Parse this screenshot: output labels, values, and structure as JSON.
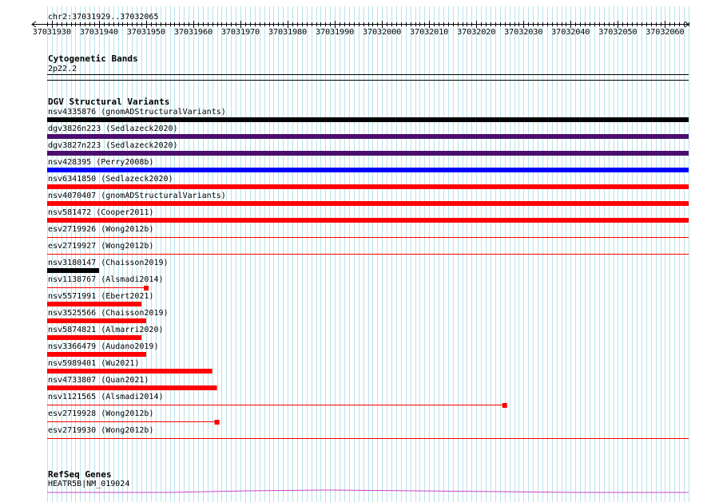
{
  "locus": "chr2:37031929..37032065",
  "ruler": {
    "start": 37031929,
    "end": 37032065,
    "tick_labels": [
      "37031930",
      "37031940",
      "37031950",
      "37031960",
      "37031970",
      "37031980",
      "37031990",
      "37032000",
      "37032010",
      "37032020",
      "37032030",
      "37032040",
      "37032050",
      "37032060"
    ]
  },
  "cytoband": {
    "title": "Cytogenetic Bands",
    "band": "2p22.2"
  },
  "dgv": {
    "title": "DGV Structural Variants",
    "variants": [
      {
        "label": "nsv4335876 (gnomADStructuralVariants)",
        "color": "#000000",
        "start": 37031929,
        "end": 37032065,
        "style": "bar"
      },
      {
        "label": "dgv3826n223 (Sedlazeck2020)",
        "color": "#4b0e6e",
        "start": 37031929,
        "end": 37032065,
        "style": "bar"
      },
      {
        "label": "dgv3827n223 (Sedlazeck2020)",
        "color": "#4b0e6e",
        "start": 37031929,
        "end": 37032065,
        "style": "bar"
      },
      {
        "label": "nsv428395 (Perry2008b)",
        "color": "#0000ff",
        "start": 37031929,
        "end": 37032065,
        "style": "bar"
      },
      {
        "label": "nsv6341850 (Sedlazeck2020)",
        "color": "#ff0000",
        "start": 37031929,
        "end": 37032065,
        "style": "bar"
      },
      {
        "label": "nsv4070407 (gnomADStructuralVariants)",
        "color": "#ff0000",
        "start": 37031929,
        "end": 37032065,
        "style": "bar"
      },
      {
        "label": "nsv581472 (Cooper2011)",
        "color": "#ff0000",
        "start": 37031929,
        "end": 37032065,
        "style": "bar"
      },
      {
        "label": "esv2719926 (Wong2012b)",
        "color": "#ff0000",
        "start": 37031929,
        "end": 37032065,
        "style": "line"
      },
      {
        "label": "esv2719927 (Wong2012b)",
        "color": "#ff0000",
        "start": 37031929,
        "end": 37032065,
        "style": "line"
      },
      {
        "label": "nsv3180147 (Chaisson2019)",
        "color": "#000000",
        "start": 37031929,
        "end": 37031940,
        "style": "bar"
      },
      {
        "label": "nsv1138767 (Alsmadi2014)",
        "color": "#ff0000",
        "start": 37031929,
        "end": 37031950,
        "style": "line-end"
      },
      {
        "label": "nsv5571991 (Ebert2021)",
        "color": "#ff0000",
        "start": 37031929,
        "end": 37031949,
        "style": "bar"
      },
      {
        "label": "nsv3525566 (Chaisson2019)",
        "color": "#ff0000",
        "start": 37031929,
        "end": 37031950,
        "style": "bar"
      },
      {
        "label": "nsv5874821 (Almarri2020)",
        "color": "#ff0000",
        "start": 37031929,
        "end": 37031949,
        "style": "bar"
      },
      {
        "label": "nsv3366479 (Audano2019)",
        "color": "#ff0000",
        "start": 37031929,
        "end": 37031950,
        "style": "bar"
      },
      {
        "label": "nsv5989401 (Wu2021)",
        "color": "#ff0000",
        "start": 37031929,
        "end": 37031964,
        "style": "bar"
      },
      {
        "label": "nsv4733807 (Quan2021)",
        "color": "#ff0000",
        "start": 37031929,
        "end": 37031965,
        "style": "bar"
      },
      {
        "label": "nsv1121565 (Alsmadi2014)",
        "color": "#ff0000",
        "start": 37031929,
        "end": 37032026,
        "style": "line-end"
      },
      {
        "label": "esv2719928 (Wong2012b)",
        "color": "#ff0000",
        "start": 37031929,
        "end": 37031965,
        "style": "line-end"
      },
      {
        "label": "esv2719930 (Wong2012b)",
        "color": "#ff0000",
        "start": 37031929,
        "end": 37032065,
        "style": "line"
      }
    ]
  },
  "refseq": {
    "title": "RefSeq Genes",
    "gene": "HEATR5B|NM_019024",
    "color": "#cc44cc"
  }
}
